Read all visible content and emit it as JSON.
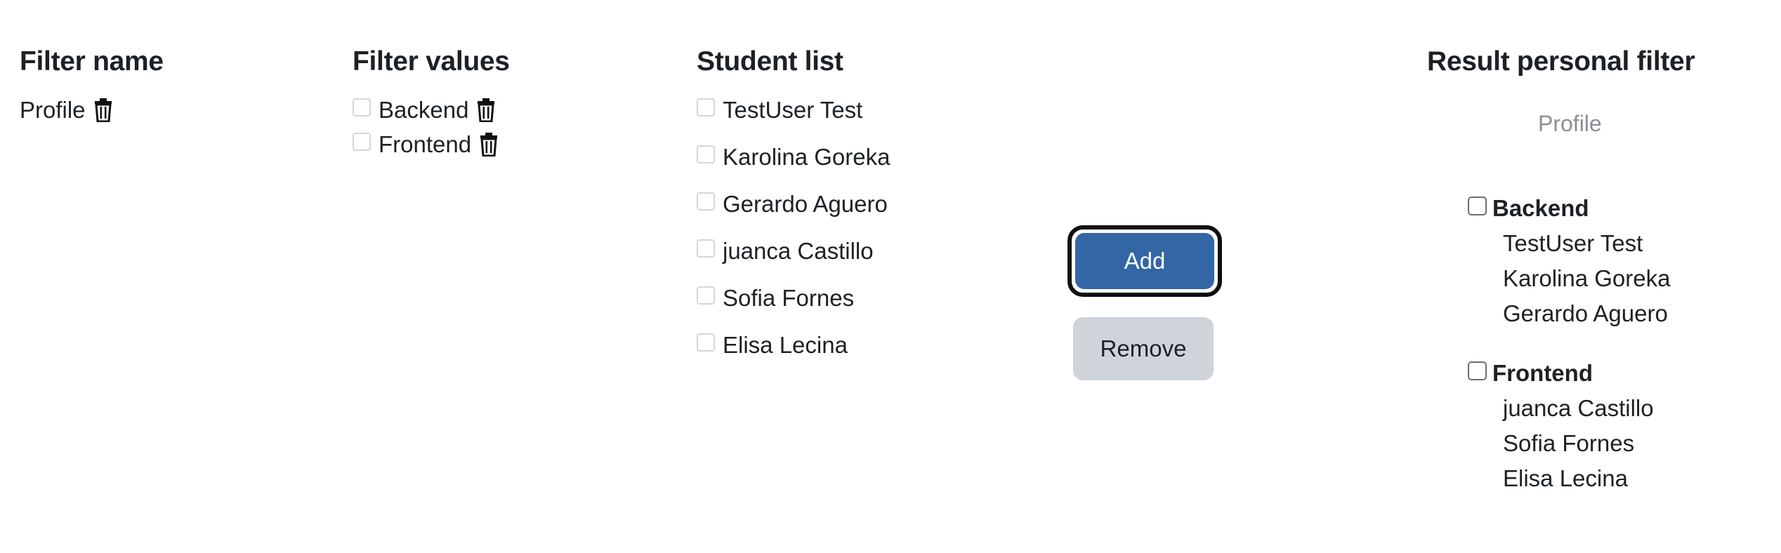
{
  "columns": {
    "filter_name": "Filter name",
    "filter_values": "Filter values",
    "student_list": "Student list",
    "result": "Result personal filter"
  },
  "filter_names": [
    {
      "label": "Profile",
      "icon": "trash-icon"
    }
  ],
  "filter_values": [
    {
      "label": "Backend",
      "checked": false,
      "icon": "trash-icon"
    },
    {
      "label": "Frontend",
      "checked": false,
      "icon": "trash-icon"
    }
  ],
  "students": [
    {
      "label": "TestUser Test",
      "checked": false
    },
    {
      "label": "Karolina Goreka",
      "checked": false
    },
    {
      "label": "Gerardo Aguero",
      "checked": false
    },
    {
      "label": "juanca Castillo",
      "checked": false
    },
    {
      "label": "Sofia Fornes",
      "checked": false
    },
    {
      "label": "Elisa Lecina",
      "checked": false
    }
  ],
  "actions": {
    "add_label": "Add",
    "remove_label": "Remove"
  },
  "result": {
    "profile_label": "Profile",
    "groups": [
      {
        "name": "Backend",
        "checked": false,
        "members": [
          "TestUser Test",
          "Karolina Goreka",
          "Gerardo Aguero"
        ]
      },
      {
        "name": "Frontend",
        "checked": false,
        "members": [
          "juanca Castillo",
          "Sofia Fornes",
          "Elisa Lecina"
        ]
      }
    ]
  },
  "colors": {
    "primary": "#3366a4",
    "secondary": "#ced4da",
    "text": "#1d2125",
    "muted": "#8a8f93"
  }
}
